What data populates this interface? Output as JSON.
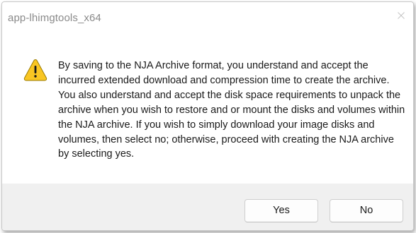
{
  "window": {
    "title": "app-lhimgtools_x64",
    "close_icon": "close-icon"
  },
  "dialog": {
    "icon": "warning-icon",
    "icon_colors": {
      "fill": "#f9c623",
      "border": "#9a7b00",
      "mark": "#1a1a1a"
    },
    "message": "By saving to the NJA Archive format, you understand and accept the incurred extended download and compression time to create the archive. You also understand and accept the disk space requirements to unpack the archive when you wish to restore and or mount the disks and volumes within the NJA archive. If you wish to simply download your image disks and volumes, then select no; otherwise, proceed with creating the NJA archive by selecting yes."
  },
  "buttons": {
    "yes_label": "Yes",
    "no_label": "No"
  }
}
